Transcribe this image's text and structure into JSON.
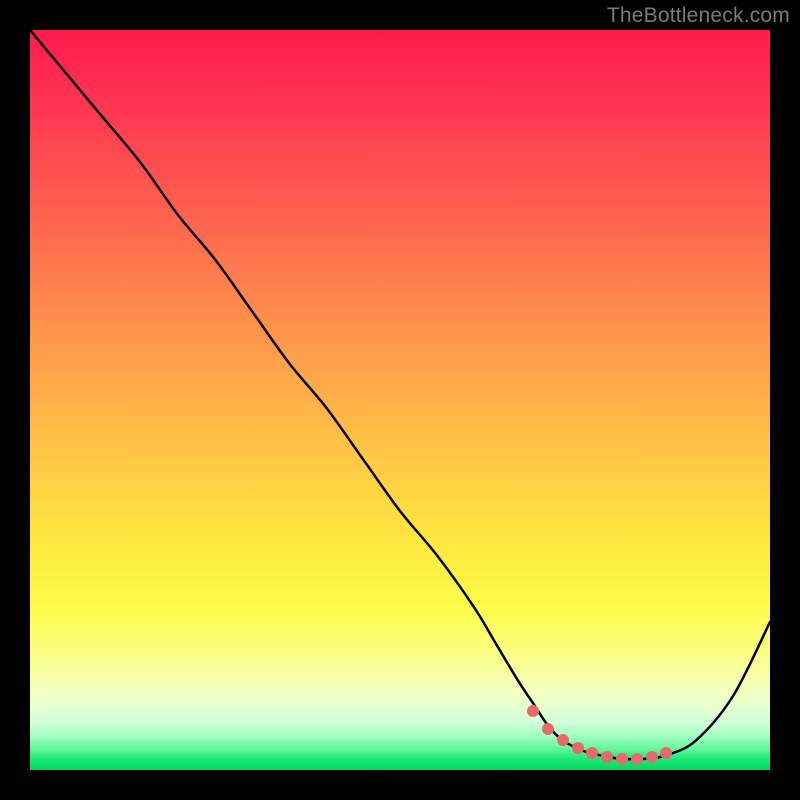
{
  "watermark": "TheBottleneck.com",
  "chart_data": {
    "type": "line",
    "title": "",
    "xlabel": "",
    "ylabel": "",
    "xlim": [
      0,
      100
    ],
    "ylim": [
      0,
      100
    ],
    "series": [
      {
        "name": "curve",
        "x": [
          0,
          5,
          10,
          15,
          20,
          25,
          30,
          35,
          40,
          45,
          50,
          55,
          60,
          63,
          66,
          68,
          70,
          72,
          75,
          78,
          80,
          83,
          86,
          90,
          95,
          100
        ],
        "y": [
          100,
          94,
          88,
          82,
          75,
          69,
          62,
          55,
          49,
          42,
          35,
          29,
          22,
          17,
          12,
          9,
          6,
          4,
          2.5,
          1.8,
          1.5,
          1.5,
          2,
          4,
          10,
          20
        ]
      },
      {
        "name": "markers",
        "x": [
          68,
          70,
          72,
          74,
          76,
          78,
          80,
          82,
          84,
          86
        ],
        "y": [
          8,
          5.5,
          4,
          3,
          2.3,
          1.8,
          1.5,
          1.5,
          1.8,
          2.3
        ]
      }
    ],
    "gradient_stops": [
      {
        "offset": 0.0,
        "color": "#ff1a4d"
      },
      {
        "offset": 0.1,
        "color": "#ff3552"
      },
      {
        "offset": 0.2,
        "color": "#ff5350"
      },
      {
        "offset": 0.3,
        "color": "#ff724e"
      },
      {
        "offset": 0.4,
        "color": "#ff914c"
      },
      {
        "offset": 0.5,
        "color": "#ffb048"
      },
      {
        "offset": 0.6,
        "color": "#ffce44"
      },
      {
        "offset": 0.7,
        "color": "#ffe93f"
      },
      {
        "offset": 0.78,
        "color": "#fdfd4a"
      },
      {
        "offset": 0.84,
        "color": "#faff80"
      },
      {
        "offset": 0.88,
        "color": "#f6ffb0"
      },
      {
        "offset": 0.91,
        "color": "#eaffce"
      },
      {
        "offset": 0.935,
        "color": "#d0ffd8"
      },
      {
        "offset": 0.955,
        "color": "#a0ffc0"
      },
      {
        "offset": 0.972,
        "color": "#60f79a"
      },
      {
        "offset": 0.985,
        "color": "#20e877"
      },
      {
        "offset": 1.0,
        "color": "#00d860"
      }
    ]
  }
}
